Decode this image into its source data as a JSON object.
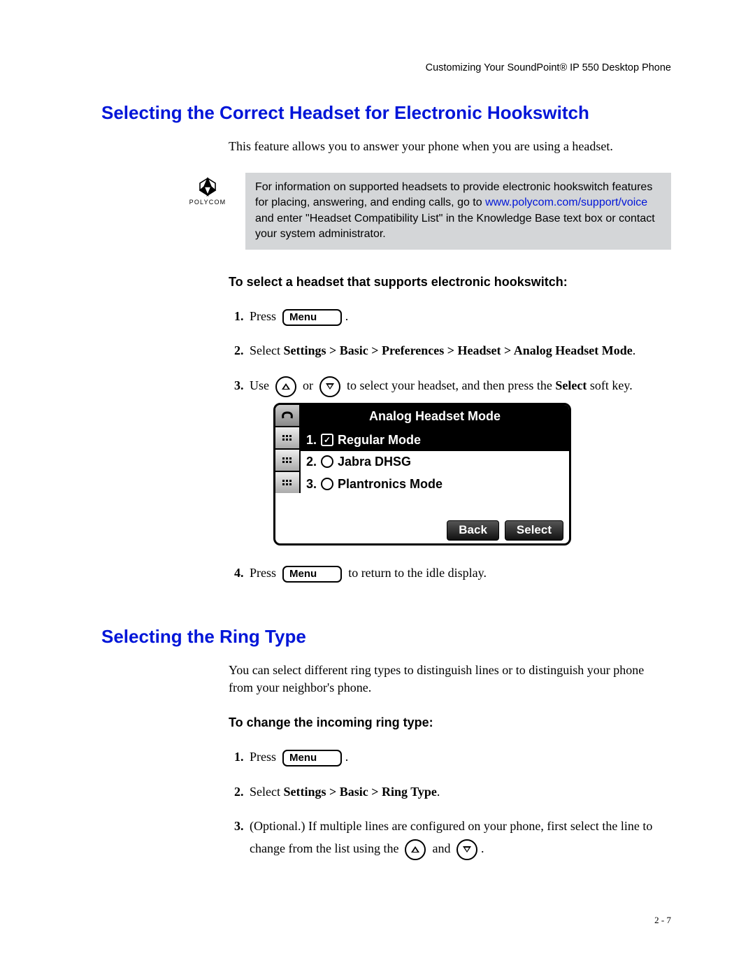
{
  "header": "Customizing Your SoundPoint® IP 550 Desktop Phone",
  "page_number": "2 - 7",
  "section1": {
    "title": "Selecting the Correct Headset for Electronic Hookswitch",
    "intro": "This feature allows you to answer your phone when you are using a headset.",
    "note_pre": "For information on supported headsets to provide electronic hookswitch features for placing, answering, and ending calls, go to ",
    "note_link": "www.polycom.com/support/voice",
    "note_post": " and enter \"Headset Compatibility List\" in the Knowledge Base text box or contact your system administrator.",
    "logo_word": "POLYCOM",
    "subhead": "To select a headset that supports electronic hookswitch:",
    "step1_press": "Press",
    "menu_label": "Menu",
    "step2_pre": "Select ",
    "step2_bold": "Settings > Basic > Preferences > Headset > Analog Headset Mode",
    "step3_use": "Use",
    "step3_or": "or",
    "step3_mid": "to select your headset, and then press the ",
    "step3_select": "Select",
    "step3_end": " soft key.",
    "phone": {
      "title": "Analog Headset Mode",
      "items": [
        {
          "num": "1.",
          "label": "Regular Mode",
          "selected": true,
          "checked": true
        },
        {
          "num": "2.",
          "label": "Jabra DHSG",
          "selected": false,
          "checked": false
        },
        {
          "num": "3.",
          "label": "Plantronics Mode",
          "selected": false,
          "checked": false
        }
      ],
      "soft_back": "Back",
      "soft_select": "Select"
    },
    "step4_press": "Press",
    "step4_end": "to return to the idle display."
  },
  "section2": {
    "title": "Selecting the Ring Type",
    "intro": "You can select different ring types to distinguish lines or to distinguish your phone from your neighbor's phone.",
    "subhead": "To change the incoming ring type:",
    "step1_press": "Press",
    "menu_label": "Menu",
    "step2_pre": "Select ",
    "step2_bold": "Settings > Basic > Ring Type",
    "step3_pre": "(Optional.) If multiple lines are configured on your phone, first select the line to change from the list using the",
    "step3_and": "and"
  }
}
